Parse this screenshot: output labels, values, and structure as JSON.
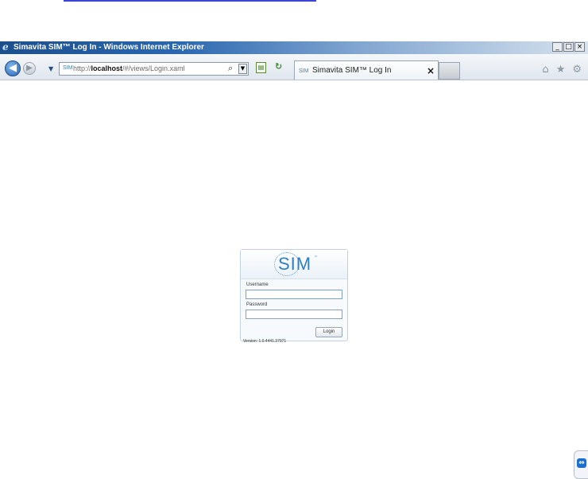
{
  "window": {
    "title": "Simavita SIM™ Log In - Windows Internet Explorer",
    "controls": {
      "minimize": "_",
      "maximize": "□",
      "close": "×"
    }
  },
  "navbar": {
    "back_glyph": "◀",
    "forward_glyph": "▶",
    "dropdown_glyph": "▼",
    "address": {
      "favicon_text": "SIM",
      "url_prefix": "http://",
      "url_host": "localhost",
      "url_path": "/#/views/Login.xaml",
      "search_glyph": "⌕",
      "dropdown_glyph": "▼"
    },
    "tab": {
      "favicon_text": "SIM",
      "label": "Simavita SIM™ Log In",
      "close_glyph": "×"
    },
    "right_icons": {
      "home": "⌂",
      "favorites": "★",
      "tools": "⚙"
    }
  },
  "login": {
    "logo_text": "SIM",
    "logo_tm": "™",
    "username_label": "Username",
    "username_value": "",
    "password_label": "Password",
    "password_value": "",
    "login_button": "Login",
    "version_text": "Version: 1.0.4441.37971"
  },
  "teamviewer": {
    "glyph": "⇔"
  }
}
